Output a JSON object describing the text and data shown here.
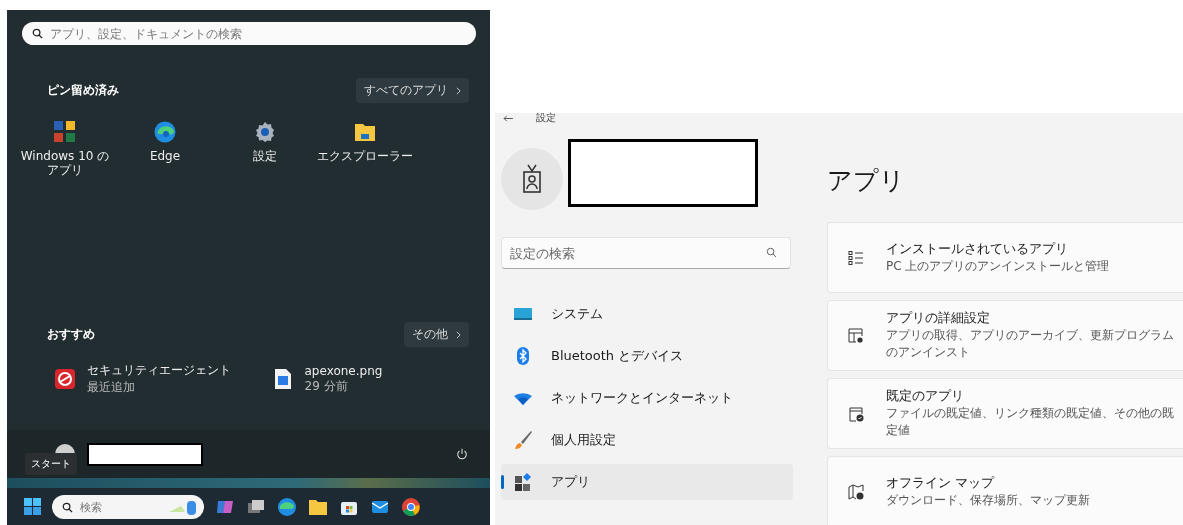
{
  "start_menu": {
    "search": {
      "placeholder": "アプリ、設定、ドキュメントの検索"
    },
    "pinned": {
      "title": "ピン留め済み",
      "more_button": "すべてのアプリ",
      "apps": [
        {
          "label": "Windows 10 のアプリ",
          "kind": "office"
        },
        {
          "label": "Edge",
          "kind": "edge"
        },
        {
          "label": "設定",
          "kind": "gear"
        },
        {
          "label": "エクスプローラー",
          "kind": "folder"
        }
      ]
    },
    "recommended": {
      "title": "おすすめ",
      "more_button": "その他",
      "items": [
        {
          "name": "セキュリティエージェント",
          "detail": "最近追加",
          "kind": "shield"
        },
        {
          "name": "apexone.png",
          "detail": "29 分前",
          "kind": "image"
        }
      ]
    },
    "tooltip": "スタート"
  },
  "taskbar": {
    "search": {
      "placeholder": "検索"
    }
  },
  "settings": {
    "title": "設定",
    "search": {
      "placeholder": "設定の検索"
    },
    "nav": [
      {
        "label": "システム",
        "kind": "system",
        "selected": false
      },
      {
        "label": "Bluetooth とデバイス",
        "kind": "bluetooth",
        "selected": false
      },
      {
        "label": "ネットワークとインターネット",
        "kind": "network",
        "selected": false
      },
      {
        "label": "個人用設定",
        "kind": "personalize",
        "selected": false
      },
      {
        "label": "アプリ",
        "kind": "apps",
        "selected": true
      }
    ],
    "page_title": "アプリ",
    "cards": [
      {
        "title": "インストールされているアプリ",
        "subtitle": "PC 上のアプリのアンインストールと管理",
        "kind": "list"
      },
      {
        "title": "アプリの詳細設定",
        "subtitle": "アプリの取得、アプリのアーカイブ、更新プログラムのアンインスト",
        "kind": "advanced"
      },
      {
        "title": "既定のアプリ",
        "subtitle": "ファイルの既定値、リンク種類の既定値、その他の既定値",
        "kind": "default"
      },
      {
        "title": "オフライン マップ",
        "subtitle": "ダウンロード、保存場所、マップ更新",
        "kind": "map"
      }
    ]
  }
}
